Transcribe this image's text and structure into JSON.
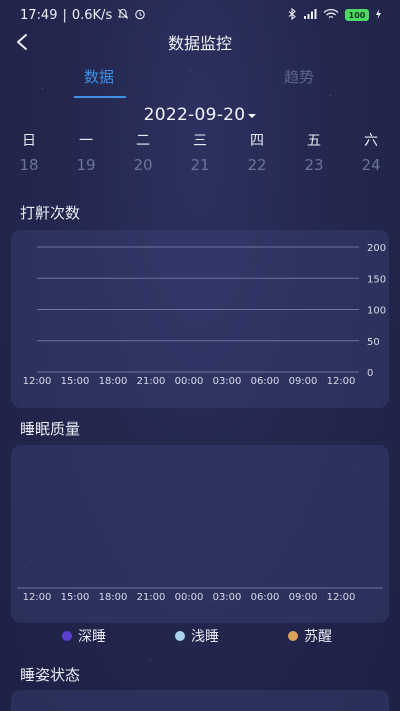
{
  "status_bar": {
    "time": "17:49",
    "net_speed": "0.6K/s",
    "battery": "100",
    "separator": "|"
  },
  "header": {
    "title": "数据监控",
    "back_icon": "chevron-left-icon"
  },
  "tabs": [
    {
      "label": "数据",
      "active": true
    },
    {
      "label": "趋势",
      "active": false
    }
  ],
  "date": "2022-09-20",
  "week": {
    "headers": [
      "日",
      "一",
      "二",
      "三",
      "四",
      "五",
      "六"
    ],
    "days": [
      "18",
      "19",
      "20",
      "21",
      "22",
      "23",
      "24"
    ]
  },
  "sections": {
    "snore": "打鼾次数",
    "sleep_quality": "睡眠质量",
    "posture": "睡姿状态"
  },
  "chart_data": [
    {
      "type": "line",
      "title": "打鼾次数",
      "x": [
        "12:00",
        "15:00",
        "18:00",
        "21:00",
        "00:00",
        "03:00",
        "06:00",
        "09:00",
        "12:00"
      ],
      "y_ticks": [
        200,
        150,
        100,
        50,
        0
      ],
      "ylim": [
        0,
        200
      ],
      "series": [],
      "grid": true
    },
    {
      "type": "bar",
      "title": "睡眠质量",
      "x": [
        "12:00",
        "15:00",
        "18:00",
        "21:00",
        "00:00",
        "03:00",
        "06:00",
        "09:00",
        "12:00"
      ],
      "series": [],
      "legend": [
        {
          "name": "深睡",
          "color": "#5b3fd1"
        },
        {
          "name": "浅睡",
          "color": "#a7d3ee"
        },
        {
          "name": "苏醒",
          "color": "#d9a35c"
        }
      ],
      "legend_position": "bottom"
    }
  ],
  "colors": {
    "accent": "#3e8fe6",
    "background": "#24284f"
  }
}
